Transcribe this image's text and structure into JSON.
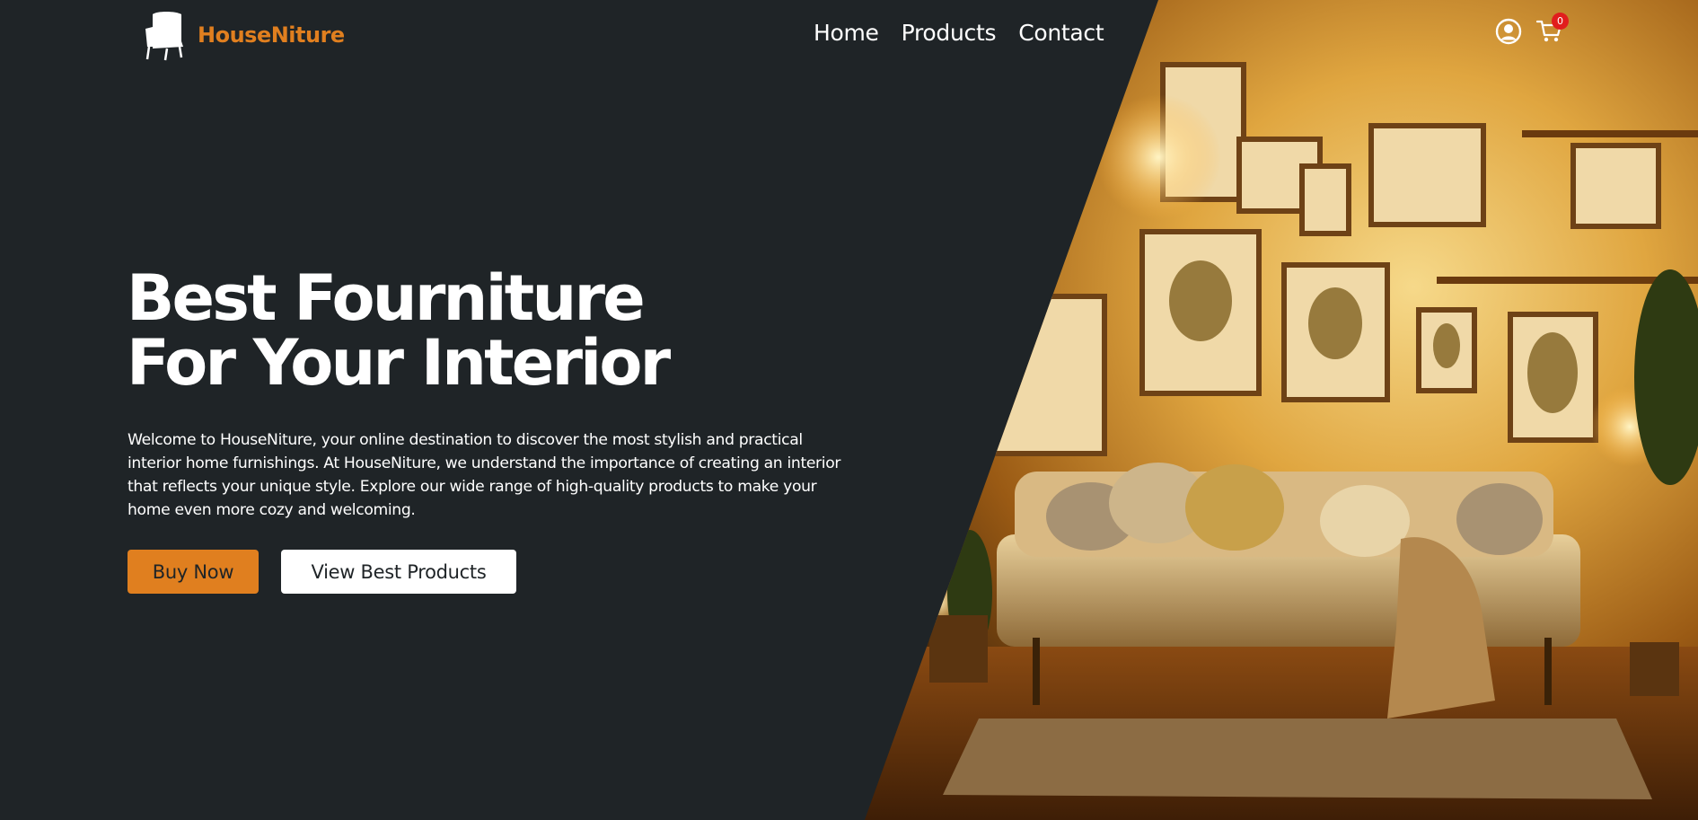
{
  "colors": {
    "background": "#1f2427",
    "brand_orange": "#e07f1f",
    "text_light": "#ffffff",
    "badge_red": "#e11d1d"
  },
  "header": {
    "logo": {
      "icon": "armchair-icon",
      "text": "HouseNiture"
    },
    "nav": [
      {
        "label": "Home"
      },
      {
        "label": "Products"
      },
      {
        "label": "Contact"
      }
    ],
    "icons": {
      "user": "user-circle-icon",
      "cart": "cart-icon",
      "cart_count": "0"
    }
  },
  "hero": {
    "title_line1": "Best Fourniture",
    "title_line2": "For Your Interior",
    "description": "Welcome to HouseNiture, your online destination to discover the most stylish and practical interior home furnishings. At HouseNiture, we understand the importance of creating an interior that reflects your unique style. Explore our wide range of high-quality products to make your home even more cozy and welcoming.",
    "buttons": {
      "buy_now": "Buy Now",
      "view_best": "View Best Products"
    },
    "image": "living-room-photo"
  }
}
